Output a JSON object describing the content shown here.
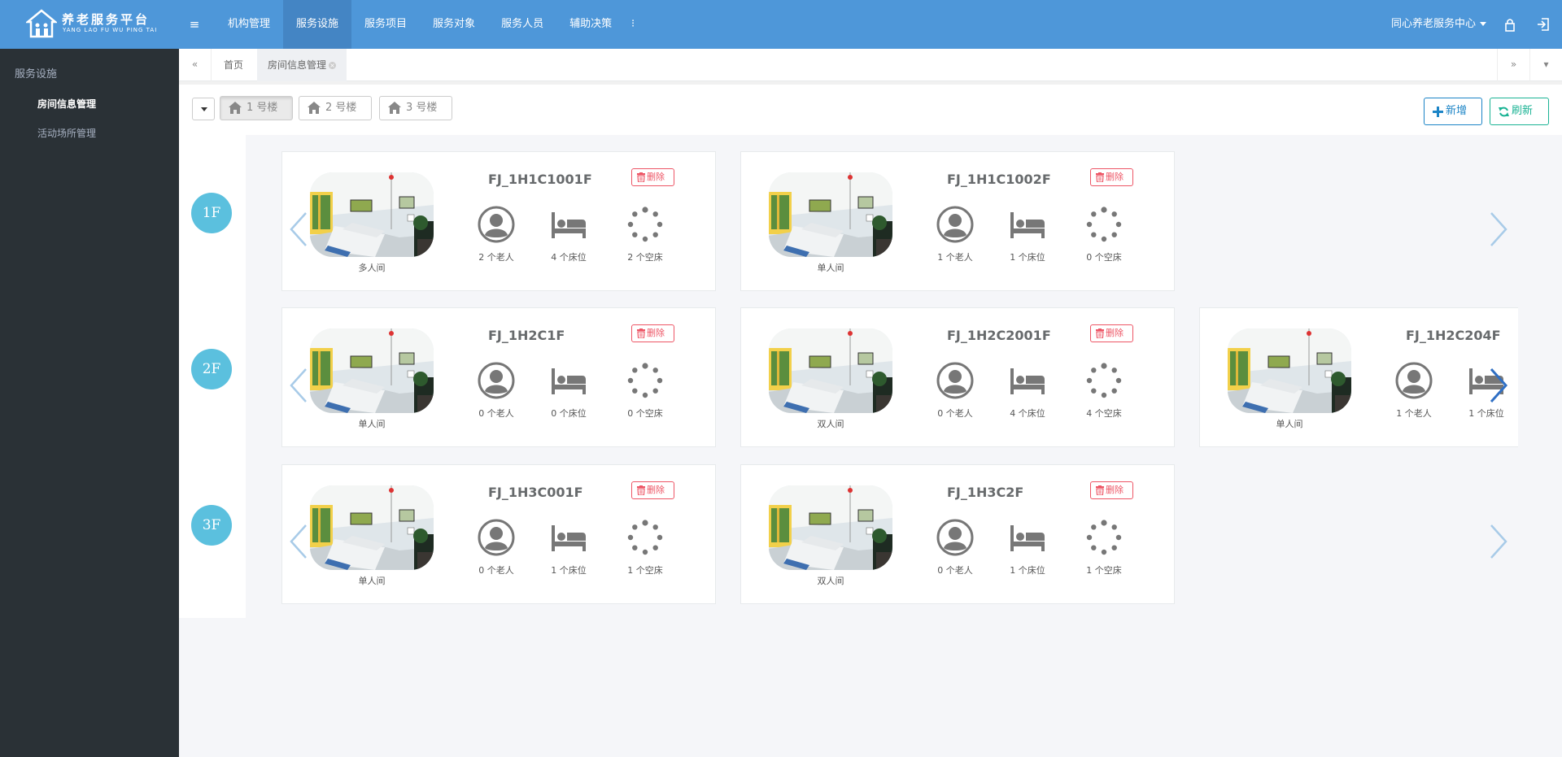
{
  "app": {
    "logo_cn": "养老服务平台",
    "logo_en": "YANG LAO FU WU PING TAI",
    "brand_color": "#4e97d9"
  },
  "nav": {
    "items": [
      "机构管理",
      "服务设施",
      "服务项目",
      "服务对象",
      "服务人员",
      "辅助决策"
    ],
    "active": "服务设施",
    "more_label": "⁝",
    "org_name": "同心养老服务中心"
  },
  "sidebar": {
    "title": "服务设施",
    "items": [
      "房间信息管理",
      "活动场所管理"
    ],
    "active": "房间信息管理"
  },
  "tabs": {
    "items": [
      "首页",
      "房间信息管理"
    ],
    "active": "房间信息管理"
  },
  "toolbar": {
    "buildings": [
      "1 号楼",
      "2 号楼",
      "3 号楼"
    ],
    "active_building": "1 号楼",
    "add_label": "新增",
    "refresh_label": "刷新"
  },
  "floors": [
    {
      "label": "1F",
      "rooms": [
        {
          "code": "FJ_1H1C1001F",
          "type": "多人间",
          "elders": "2 个老人",
          "beds": "4 个床位",
          "free": "2 个空床",
          "delete": "删除"
        },
        {
          "code": "FJ_1H1C1002F",
          "type": "单人间",
          "elders": "1 个老人",
          "beds": "1 个床位",
          "free": "0 个空床",
          "delete": "删除"
        }
      ]
    },
    {
      "label": "2F",
      "rooms": [
        {
          "code": "FJ_1H2C1F",
          "type": "单人间",
          "elders": "0 个老人",
          "beds": "0 个床位",
          "free": "0 个空床",
          "delete": "删除"
        },
        {
          "code": "FJ_1H2C2001F",
          "type": "双人间",
          "elders": "0 个老人",
          "beds": "4 个床位",
          "free": "4 个空床",
          "delete": "删除"
        },
        {
          "code": "FJ_1H2C204F",
          "type": "单人间",
          "elders": "1 个老人",
          "beds": "1 个床位",
          "free": "",
          "delete": ""
        }
      ]
    },
    {
      "label": "3F",
      "rooms": [
        {
          "code": "FJ_1H3C001F",
          "type": "单人间",
          "elders": "0 个老人",
          "beds": "1 个床位",
          "free": "1 个空床",
          "delete": "删除"
        },
        {
          "code": "FJ_1H3C2F",
          "type": "双人间",
          "elders": "0 个老人",
          "beds": "1 个床位",
          "free": "1 个空床",
          "delete": "删除"
        }
      ]
    }
  ]
}
